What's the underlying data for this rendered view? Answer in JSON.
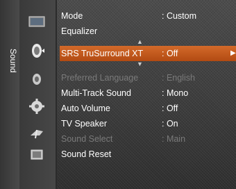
{
  "tab": {
    "label": "Sound"
  },
  "icons": [
    "picture-icon",
    "sound-icon",
    "channel-icon",
    "setup-icon",
    "input-icon",
    "application-icon"
  ],
  "menu": {
    "items": [
      {
        "label": "Mode",
        "value": ": Custom",
        "enabled": true
      },
      {
        "label": "Equalizer",
        "value": "",
        "enabled": true
      },
      {
        "label": "SRS TruSurround XT",
        "value": ": Off",
        "enabled": true,
        "selected": true
      },
      {
        "label": "Preferred Language",
        "value": ": English",
        "enabled": false
      },
      {
        "label": "Multi-Track Sound",
        "value": ": Mono",
        "enabled": true
      },
      {
        "label": "Auto Volume",
        "value": ": Off",
        "enabled": true
      },
      {
        "label": "TV Speaker",
        "value": ": On",
        "enabled": true
      },
      {
        "label": "Sound Select",
        "value": ": Main",
        "enabled": false
      },
      {
        "label": "Sound Reset",
        "value": "",
        "enabled": true
      }
    ]
  },
  "colors": {
    "highlight": "#c4561b",
    "text": "#ffffff",
    "disabled": "#7a7a7a"
  }
}
